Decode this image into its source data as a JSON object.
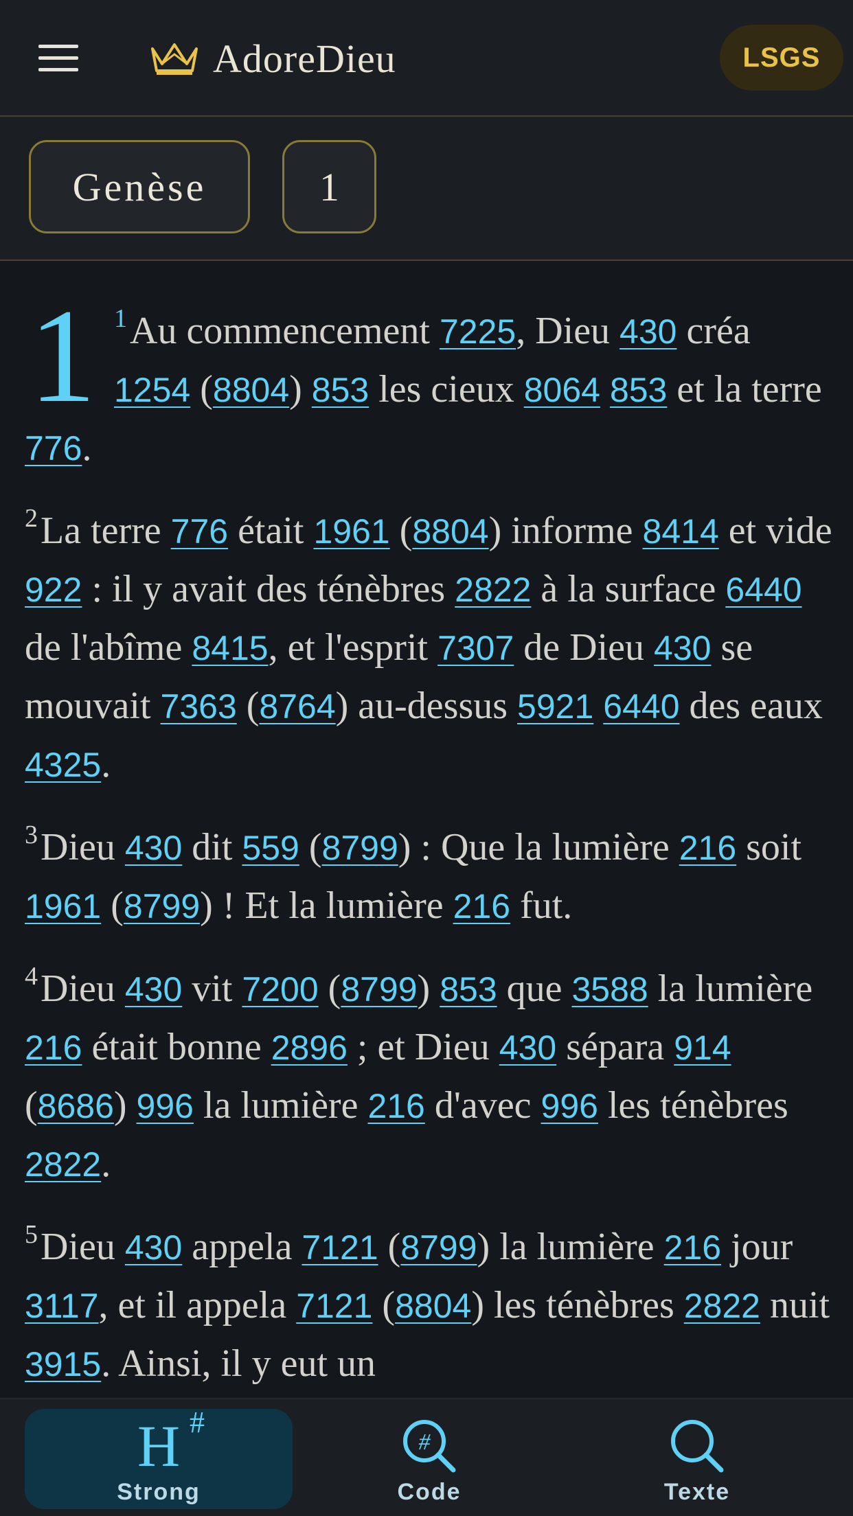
{
  "header": {
    "app_name": "AdoreDieu",
    "version": "LSGS"
  },
  "selector": {
    "book": "Genèse",
    "chapter": "1"
  },
  "passage": {
    "chapter_number": "1",
    "verses": [
      {
        "num": "1",
        "segments": [
          {
            "t": "Au commencement "
          },
          {
            "s": "7225"
          },
          {
            "t": ", Dieu "
          },
          {
            "s": "430"
          },
          {
            "t": " créa "
          },
          {
            "s": "1254"
          },
          {
            "t": " ("
          },
          {
            "s": "8804"
          },
          {
            "t": ") "
          },
          {
            "s": "853"
          },
          {
            "t": " les cieux "
          },
          {
            "s": "8064"
          },
          {
            "t": " "
          },
          {
            "s": "853"
          },
          {
            "t": " et la terre "
          },
          {
            "s": "776"
          },
          {
            "t": "."
          }
        ]
      },
      {
        "num": "2",
        "segments": [
          {
            "t": "La terre "
          },
          {
            "s": "776"
          },
          {
            "t": " était "
          },
          {
            "s": "1961"
          },
          {
            "t": " ("
          },
          {
            "s": "8804"
          },
          {
            "t": ") informe "
          },
          {
            "s": "8414"
          },
          {
            "t": " et vide "
          },
          {
            "s": "922"
          },
          {
            "t": " : il y avait des ténèbres "
          },
          {
            "s": "2822"
          },
          {
            "t": " à la surface "
          },
          {
            "s": "6440"
          },
          {
            "t": " de l'abîme "
          },
          {
            "s": "8415"
          },
          {
            "t": ", et l'esprit "
          },
          {
            "s": "7307"
          },
          {
            "t": " de Dieu "
          },
          {
            "s": "430"
          },
          {
            "t": " se mouvait "
          },
          {
            "s": "7363"
          },
          {
            "t": " ("
          },
          {
            "s": "8764"
          },
          {
            "t": ") au-dessus "
          },
          {
            "s": "5921"
          },
          {
            "t": " "
          },
          {
            "s": "6440"
          },
          {
            "t": " des eaux "
          },
          {
            "s": "4325"
          },
          {
            "t": "."
          }
        ]
      },
      {
        "num": "3",
        "segments": [
          {
            "t": "Dieu "
          },
          {
            "s": "430"
          },
          {
            "t": " dit "
          },
          {
            "s": "559"
          },
          {
            "t": " ("
          },
          {
            "s": "8799"
          },
          {
            "t": ") : Que la lumière "
          },
          {
            "s": "216"
          },
          {
            "t": " soit "
          },
          {
            "s": "1961"
          },
          {
            "t": " ("
          },
          {
            "s": "8799"
          },
          {
            "t": ") ! Et la lumière "
          },
          {
            "s": "216"
          },
          {
            "t": " fut."
          }
        ]
      },
      {
        "num": "4",
        "segments": [
          {
            "t": "Dieu "
          },
          {
            "s": "430"
          },
          {
            "t": " vit "
          },
          {
            "s": "7200"
          },
          {
            "t": " ("
          },
          {
            "s": "8799"
          },
          {
            "t": ") "
          },
          {
            "s": "853"
          },
          {
            "t": " que "
          },
          {
            "s": "3588"
          },
          {
            "t": " la lumière "
          },
          {
            "s": "216"
          },
          {
            "t": " était bonne "
          },
          {
            "s": "2896"
          },
          {
            "t": " ; et Dieu "
          },
          {
            "s": "430"
          },
          {
            "t": " sépara "
          },
          {
            "s": "914"
          },
          {
            "t": " ("
          },
          {
            "s": "8686"
          },
          {
            "t": ") "
          },
          {
            "s": "996"
          },
          {
            "t": " la lumière "
          },
          {
            "s": "216"
          },
          {
            "t": " d'avec "
          },
          {
            "s": "996"
          },
          {
            "t": " les ténèbres "
          },
          {
            "s": "2822"
          },
          {
            "t": "."
          }
        ]
      },
      {
        "num": "5",
        "segments": [
          {
            "t": "Dieu "
          },
          {
            "s": "430"
          },
          {
            "t": " appela "
          },
          {
            "s": "7121"
          },
          {
            "t": " ("
          },
          {
            "s": "8799"
          },
          {
            "t": ") la lumière "
          },
          {
            "s": "216"
          },
          {
            "t": " jour "
          },
          {
            "s": "3117"
          },
          {
            "t": ", et il appela "
          },
          {
            "s": "7121"
          },
          {
            "t": " ("
          },
          {
            "s": "8804"
          },
          {
            "t": ") les ténèbres "
          },
          {
            "s": "2822"
          },
          {
            "t": " nuit "
          },
          {
            "s": "3915"
          },
          {
            "t": ". Ainsi, il y eut un"
          }
        ]
      }
    ]
  },
  "bottom_nav": {
    "strong": "Strong",
    "code": "Code",
    "texte": "Texte",
    "strong_icon_text": "H",
    "strong_icon_sup": "#"
  },
  "colors": {
    "accent": "#5fd1f7",
    "gold": "#e9c24a",
    "background": "#14171b"
  }
}
